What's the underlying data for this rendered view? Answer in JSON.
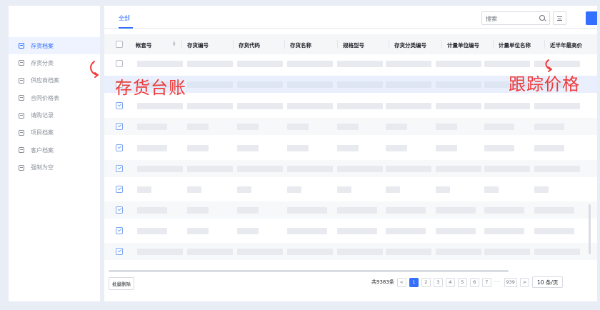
{
  "sidebar": {
    "items": [
      {
        "label": "存货档案",
        "active": true
      },
      {
        "label": "存货分类",
        "active": false
      },
      {
        "label": "供应商档案",
        "active": false
      },
      {
        "label": "合同价格表",
        "active": false
      },
      {
        "label": "请购记录",
        "active": false
      },
      {
        "label": "项目档案",
        "active": false
      },
      {
        "label": "客户档案",
        "active": false
      },
      {
        "label": "强制为空",
        "active": false
      }
    ]
  },
  "tabs": {
    "all": "全部"
  },
  "search": {
    "placeholder": "搜索"
  },
  "table": {
    "columns": [
      "帐套号",
      "存货编号",
      "存货代码",
      "存货名称",
      "规格型号",
      "存货分类编号",
      "计量单位编号",
      "计量单位名称",
      "近半年最高价"
    ]
  },
  "footer": {
    "batch_delete": "批量删除",
    "total": "共9383条",
    "pages": [
      "1",
      "2",
      "3",
      "4",
      "5",
      "6",
      "7"
    ],
    "ellipsis": "···",
    "last_page": "939",
    "prev": "<",
    "next": ">",
    "page_size": "10 条/页"
  },
  "annotations": {
    "left": "存货台账",
    "right": "跟踪价格"
  },
  "colors": {
    "accent": "#3370ff",
    "annotation": "#ef3b3b"
  }
}
